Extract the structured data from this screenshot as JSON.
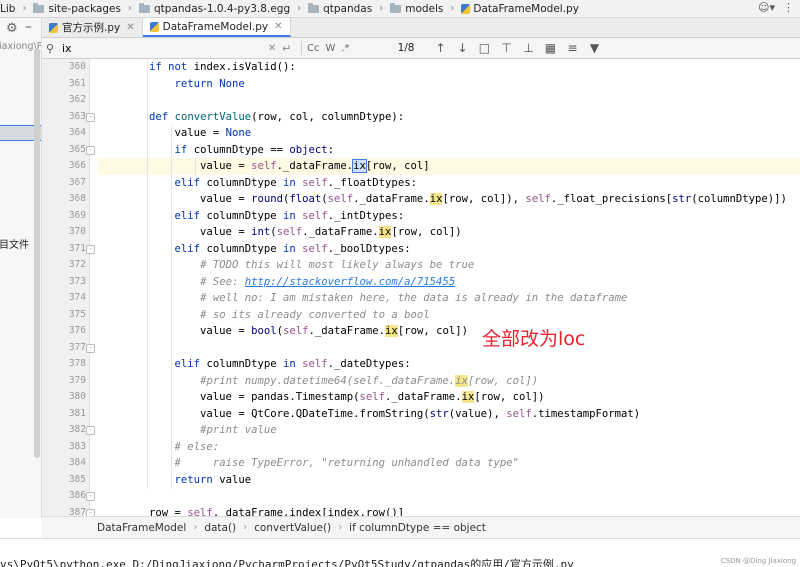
{
  "nav": {
    "crumbs": [
      "Lib",
      "site-packages",
      "qtpandas-1.0.4-py3.8.egg",
      "qtpandas",
      "models",
      "DataFrameModel.py"
    ],
    "user_icon": "user-icon"
  },
  "left": {
    "project_label": "iaxiong\\PyC",
    "file_label": "目文件"
  },
  "tabs": [
    {
      "label": "官方示例.py"
    },
    {
      "label": "DataFrameModel.py"
    }
  ],
  "find": {
    "query": "ix",
    "count": "1/8",
    "case_label": "Cc",
    "words_label": "W",
    "regex_label": ".*"
  },
  "editor": {
    "lines": [
      "360",
      "361",
      "362",
      "363",
      "364",
      "365",
      "366",
      "367",
      "368",
      "369",
      "370",
      "371",
      "372",
      "373",
      "374",
      "375",
      "376",
      "377",
      "378",
      "379",
      "380",
      "381",
      "382",
      "383",
      "384",
      "385",
      "386",
      "387"
    ],
    "current_line": "366"
  },
  "annotation": "全部改为loc",
  "code_breadcrumb": [
    "DataFrameModel",
    "data()",
    "convertValue()",
    "if columnDtype == object"
  ],
  "run_line": "vs\\PyQt5\\python.exe D:/DingJiaxiong/PycharmProjects/PyQt5Study/qtpandas的应用/官方示例.py",
  "watermark": "CSDN @Ding Jiaxiong"
}
